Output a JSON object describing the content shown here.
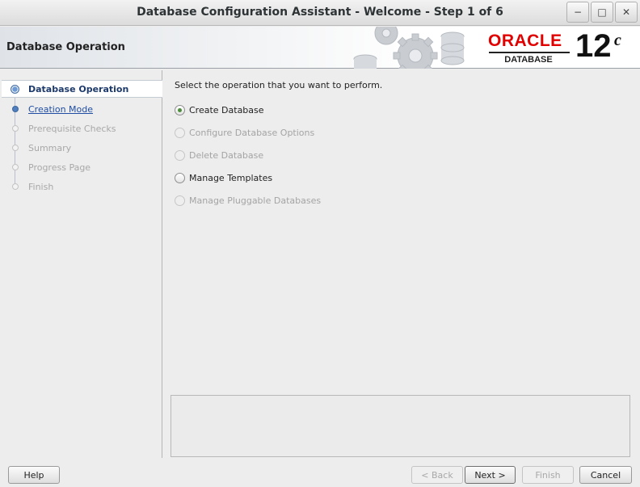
{
  "window": {
    "title": "Database Configuration Assistant - Welcome - Step 1 of 6",
    "controls": {
      "minimize": "−",
      "maximize": "□",
      "close": "✕"
    }
  },
  "header": {
    "heading": "Database Operation",
    "brand": {
      "name": "ORACLE",
      "registered": "®",
      "product": "DATABASE",
      "version": "12",
      "version_suffix": "c",
      "color": "#e10000"
    }
  },
  "steps": [
    {
      "label": "Database Operation",
      "state": "current"
    },
    {
      "label": "Creation Mode",
      "state": "done"
    },
    {
      "label": "Prerequisite Checks",
      "state": "pending"
    },
    {
      "label": "Summary",
      "state": "pending"
    },
    {
      "label": "Progress Page",
      "state": "pending"
    },
    {
      "label": "Finish",
      "state": "pending"
    }
  ],
  "main": {
    "prompt": "Select the operation that you want to perform.",
    "options": [
      {
        "label": "Create Database",
        "selected": true,
        "enabled": true
      },
      {
        "label": "Configure Database Options",
        "selected": false,
        "enabled": false
      },
      {
        "label": "Delete Database",
        "selected": false,
        "enabled": false
      },
      {
        "label": "Manage Templates",
        "selected": false,
        "enabled": true
      },
      {
        "label": "Manage Pluggable Databases",
        "selected": false,
        "enabled": false
      }
    ]
  },
  "footer": {
    "help": "Help",
    "back": "< Back",
    "next": "Next >",
    "finish": "Finish",
    "cancel": "Cancel"
  }
}
